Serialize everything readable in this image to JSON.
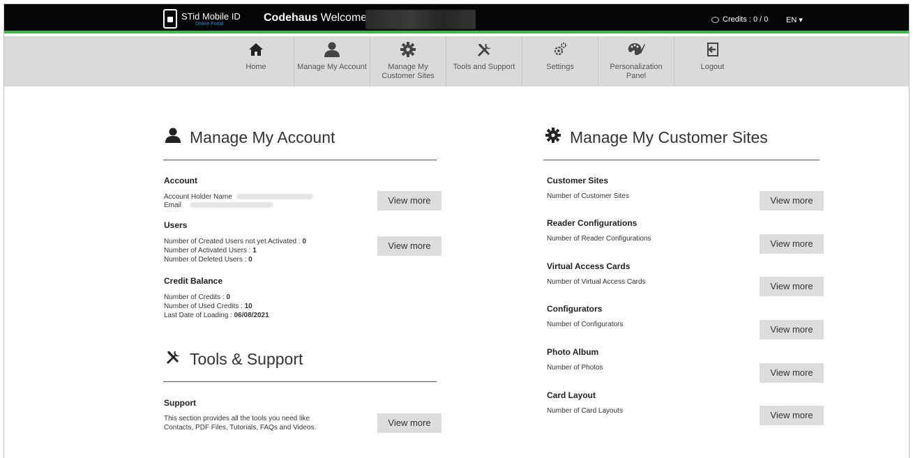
{
  "header": {
    "brand_name": "STid Mobile ID",
    "brand_sub": "Online Portal",
    "welcome_bold": "Codehaus",
    "welcome_text": " Welcome",
    "credits": "Credits : 0 / 0",
    "language": "EN ▾"
  },
  "nav": [
    {
      "label": "Home",
      "icon": "home-icon"
    },
    {
      "label": "Manage My Account",
      "icon": "user-icon"
    },
    {
      "label": "Manage My Customer Sites",
      "icon": "gear-icon"
    },
    {
      "label": "Tools and Support",
      "icon": "tools-icon"
    },
    {
      "label": "Settings",
      "icon": "settings-icon"
    },
    {
      "label": "Personalization Panel",
      "icon": "palette-icon"
    },
    {
      "label": "Logout",
      "icon": "logout-icon"
    }
  ],
  "account": {
    "title": "Manage My Account",
    "account_h": "Account",
    "holder_label": "Account Holder Name",
    "email_label": "Email",
    "users_h": "Users",
    "users_not_activated_label": "Number of Created Users not yet Activated : ",
    "users_not_activated": "0",
    "users_activated_label": "Number of Activated Users : ",
    "users_activated": "1",
    "users_deleted_label": "Number of Deleted Users : ",
    "users_deleted": "0",
    "credit_h": "Credit Balance",
    "credits_label": "Number of Credits : ",
    "credits": "0",
    "used_label": "Number of Used Credits : ",
    "used": "10",
    "last_label": "Last Date of Loading : ",
    "last": "06/08/2021"
  },
  "tools": {
    "title": "Tools & Support",
    "support_h": "Support",
    "support_line1": "This section provides all the tools you need like",
    "support_line2": "Contacts, PDF Files, Tutorials, FAQs and Videos."
  },
  "sites": {
    "title": "Manage My Customer Sites",
    "items": [
      {
        "heading": "Customer Sites",
        "desc": "Number of Customer Sites"
      },
      {
        "heading": "Reader Configurations",
        "desc": "Number of Reader Configurations"
      },
      {
        "heading": "Virtual Access Cards",
        "desc": "Number of Virtual Access Cards"
      },
      {
        "heading": "Configurators",
        "desc": "Number of Configurators"
      },
      {
        "heading": "Photo Album",
        "desc": "Number of Photos"
      },
      {
        "heading": "Card Layout",
        "desc": "Number of Card Layouts"
      }
    ]
  },
  "buttons": {
    "view_more": "View more"
  }
}
